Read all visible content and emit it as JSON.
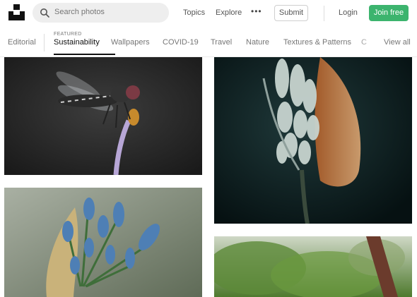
{
  "header": {
    "search_placeholder": "Search photos",
    "nav": {
      "topics": "Topics",
      "explore": "Explore"
    },
    "more_label": "•••",
    "submit_label": "Submit",
    "login_label": "Login",
    "join_label": "Join free"
  },
  "tabs": {
    "featured_caption": "FEATURED",
    "items": [
      "Editorial",
      "Sustainability",
      "Wallpapers",
      "COVID-19",
      "Travel",
      "Nature",
      "Textures & Patterns",
      "C",
      "View all"
    ],
    "active": "Sustainability"
  },
  "colors": {
    "brand": "#111111",
    "join_button": "#3cb46e"
  },
  "icons": [
    "unsplash-logo-icon",
    "search-icon"
  ]
}
